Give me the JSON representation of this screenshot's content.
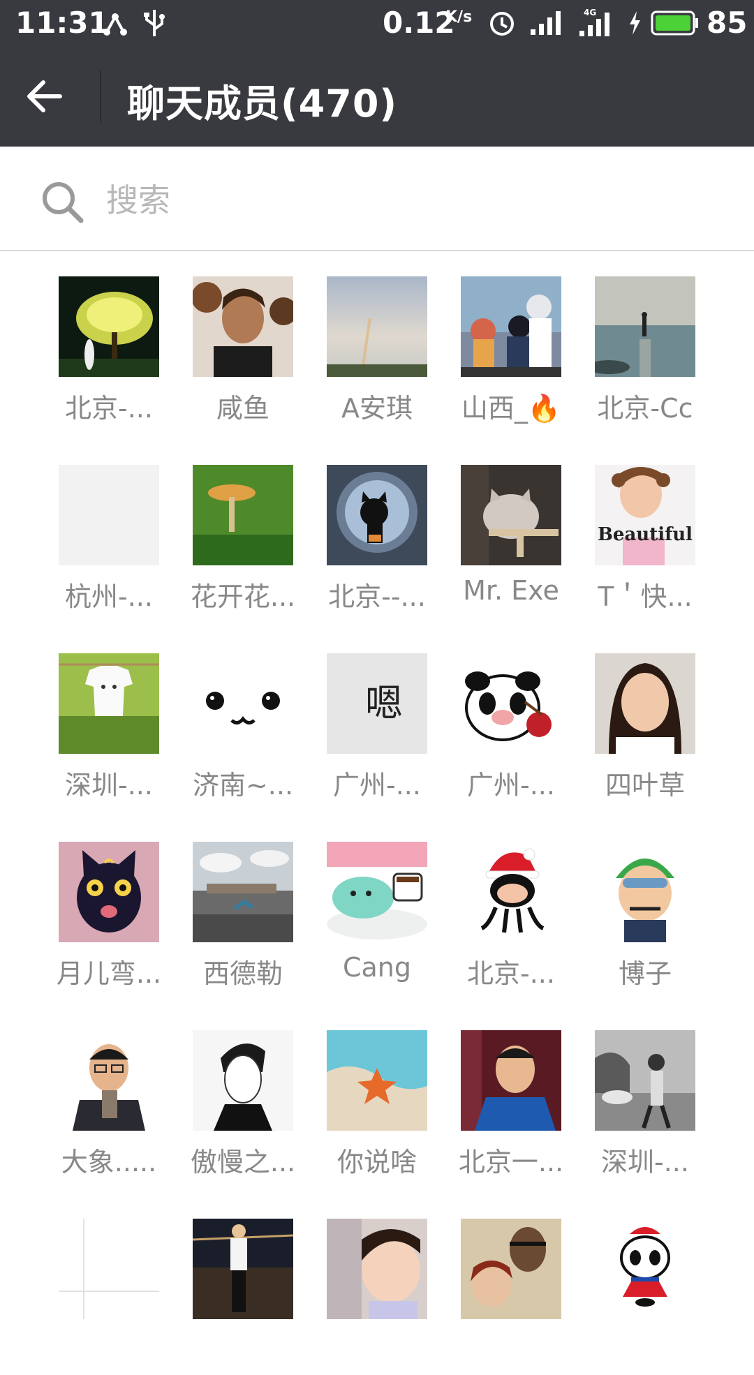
{
  "status_bar": {
    "time": "11:31",
    "speed": "0.12",
    "speed_unit": "K/s",
    "network": "4G",
    "battery": "85",
    "icons": [
      "share-icon",
      "usb-icon",
      "alarm-icon",
      "signal-icon",
      "signal-4g-icon",
      "charging-icon",
      "battery-icon"
    ]
  },
  "header": {
    "title": "聊天成员(470)",
    "back_icon": "back-arrow-icon"
  },
  "search": {
    "placeholder": "搜索"
  },
  "members": [
    {
      "name": "北京-...",
      "avatar": "night-tree-avatar"
    },
    {
      "name": "咸鱼",
      "avatar": "man-portrait-avatar"
    },
    {
      "name": "A安琪",
      "avatar": "rainbow-sky-avatar"
    },
    {
      "name": "山西_🔥",
      "avatar": "anime-scene-avatar"
    },
    {
      "name": "北京-Cc",
      "avatar": "sea-pier-avatar"
    },
    {
      "name": "杭州-...",
      "avatar": "blank-avatar"
    },
    {
      "name": "花开花...",
      "avatar": "mushroom-avatar"
    },
    {
      "name": "北京--...",
      "avatar": "cat-window-avatar"
    },
    {
      "name": "Mr. Exe",
      "avatar": "cat-photo-avatar"
    },
    {
      "name": "T＇快...",
      "avatar": "girl-beautiful-avatar",
      "caption": "Beautiful"
    },
    {
      "name": "深圳-...",
      "avatar": "tshirt-grass-avatar"
    },
    {
      "name": "济南~...",
      "avatar": "cute-face-avatar"
    },
    {
      "name": "广州-...",
      "avatar": "calligraphy-avatar",
      "caption": "嗯"
    },
    {
      "name": "广州-...",
      "avatar": "panda-pig-avatar"
    },
    {
      "name": "四叶草",
      "avatar": "girl-selfie-avatar"
    },
    {
      "name": "月儿弯...",
      "avatar": "black-cat-avatar"
    },
    {
      "name": "西德勒",
      "avatar": "palace-jump-avatar"
    },
    {
      "name": "Cang",
      "avatar": "green-dino-avatar"
    },
    {
      "name": "北京-...",
      "avatar": "santa-octocat-avatar"
    },
    {
      "name": "博子",
      "avatar": "anime-zoro-avatar"
    },
    {
      "name": "大象.....",
      "avatar": "glasses-man-avatar"
    },
    {
      "name": "傲慢之...",
      "avatar": "sketch-man-avatar"
    },
    {
      "name": "你说啥",
      "avatar": "starfish-avatar"
    },
    {
      "name": "北京一...",
      "avatar": "young-man-avatar"
    },
    {
      "name": "深圳-...",
      "avatar": "bw-street-avatar"
    },
    {
      "name": "",
      "avatar": "blank-lines-avatar"
    },
    {
      "name": "",
      "avatar": "night-woman-avatar"
    },
    {
      "name": "",
      "avatar": "child-avatar"
    },
    {
      "name": "",
      "avatar": "couple-avatar"
    },
    {
      "name": "",
      "avatar": "panda-hero-avatar"
    }
  ]
}
